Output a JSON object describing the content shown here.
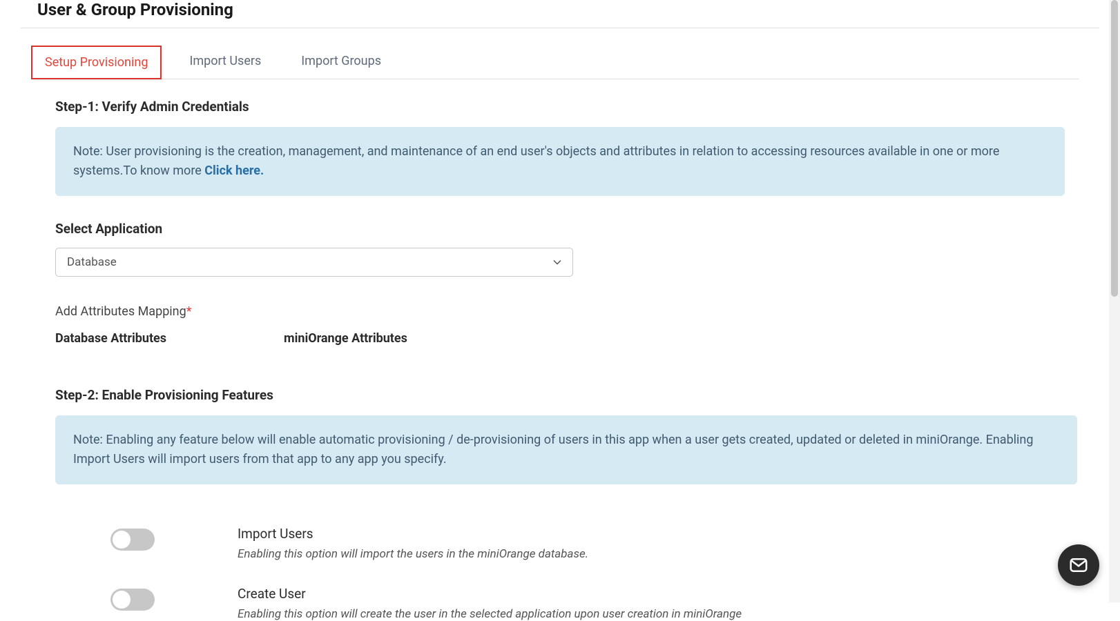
{
  "page_title": "User & Group Provisioning",
  "tabs": [
    {
      "label": "Setup Provisioning",
      "active": true
    },
    {
      "label": "Import Users",
      "active": false
    },
    {
      "label": "Import Groups",
      "active": false
    }
  ],
  "step1": {
    "heading": "Step-1: Verify Admin Credentials",
    "note_prefix": "Note: User provisioning is the creation, management, and maintenance of an end user's objects and attributes in relation to accessing resources available in one or more systems.To know more ",
    "note_link": "Click here."
  },
  "select_app": {
    "label": "Select Application",
    "value": "Database"
  },
  "attr_mapping": {
    "label": "Add Attributes Mapping",
    "required_marker": "*",
    "col1": "Database Attributes",
    "col2": "miniOrange Attributes"
  },
  "step2": {
    "heading": "Step-2: Enable Provisioning Features",
    "note": "Note: Enabling any feature below will enable automatic provisioning / de-provisioning of users in this app when a user gets created, updated or deleted in miniOrange. Enabling Import Users will import users from that app to any app you specify."
  },
  "features": [
    {
      "title": "Import Users",
      "desc": "Enabling this option will import the users in the miniOrange database.",
      "enabled": false
    },
    {
      "title": "Create User",
      "desc": "Enabling this option will create the user in the selected application upon user creation in miniOrange",
      "enabled": false
    }
  ]
}
